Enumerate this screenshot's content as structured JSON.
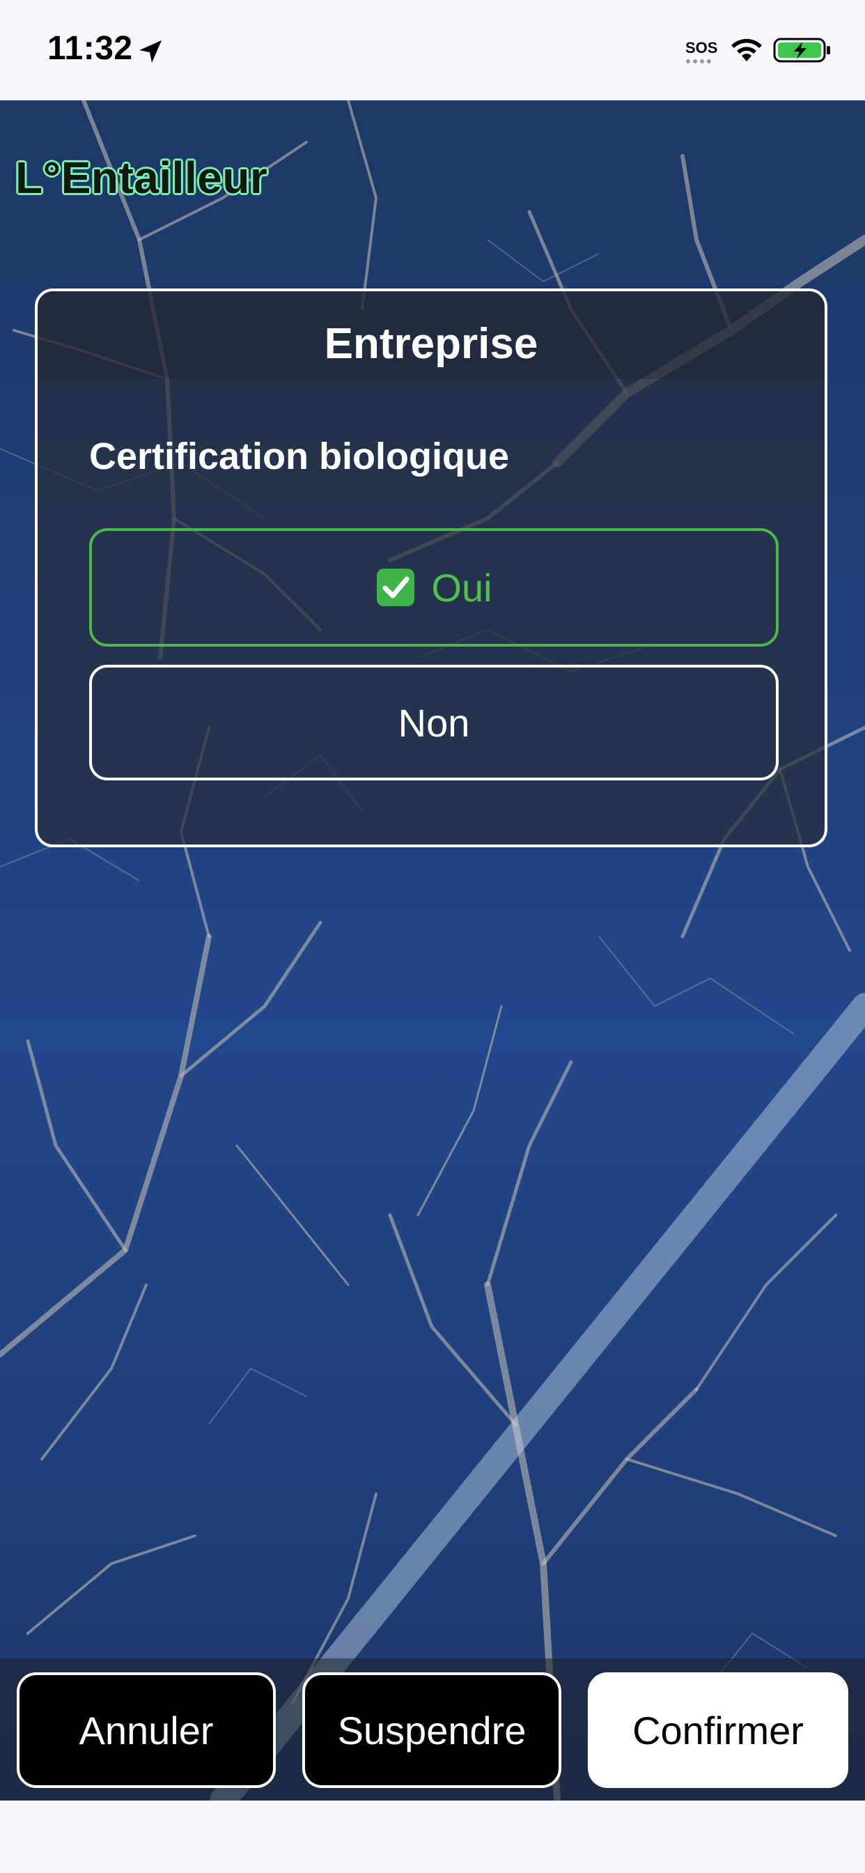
{
  "status_bar": {
    "time": "11:32",
    "sos_label": "SOS",
    "icons": [
      "location-arrow-icon",
      "wifi-icon",
      "battery-charging-icon"
    ]
  },
  "app": {
    "logo_text": "L°Entailleur"
  },
  "card": {
    "title": "Entreprise",
    "question": "Certification biologique",
    "options": [
      {
        "label": "Oui",
        "selected": true,
        "icon": "checkmark-box-icon"
      },
      {
        "label": "Non",
        "selected": false
      }
    ]
  },
  "actions": {
    "cancel_label": "Annuler",
    "suspend_label": "Suspendre",
    "confirm_label": "Confirmer"
  },
  "colors": {
    "selected_option": "#4cb84a",
    "logo_outline": "#7ff0b0",
    "sky": "#1f3f7a"
  }
}
